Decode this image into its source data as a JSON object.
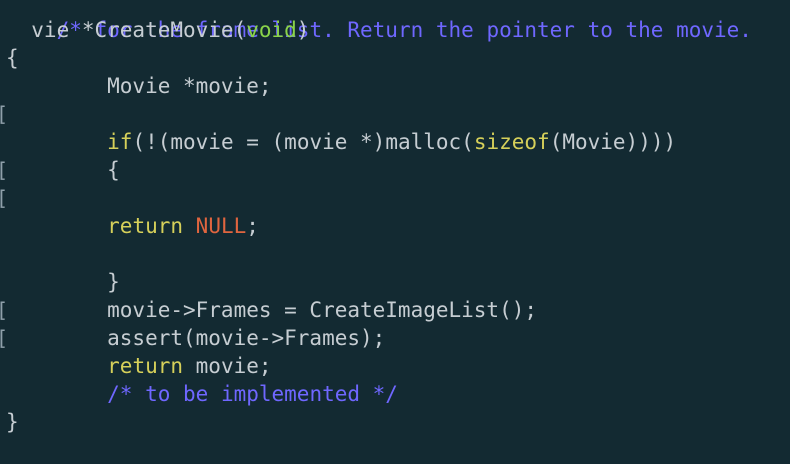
{
  "code": {
    "line0": {
      "comment": "/* for the frame list. Return the pointer to the movie."
    },
    "line1": {
      "pre": "  vie *CreateMovie(",
      "void": "void",
      "post": ")"
    },
    "line2": {
      "brace": "{"
    },
    "line3": {
      "text": "        Movie *movie;"
    },
    "line5": {
      "indent": "        ",
      "kw_if": "if",
      "mid": "(!(movie = (movie *)malloc(",
      "kw_sizeof": "sizeof",
      "tail": "(Movie))))"
    },
    "line6": {
      "text": "        {"
    },
    "line8": {
      "indent": "        ",
      "kw_return": "return",
      "space": " ",
      "null": "NULL",
      "semi": ";"
    },
    "line10": {
      "text": "        }"
    },
    "line11": {
      "text": "        movie->Frames = CreateImageList();"
    },
    "line12": {
      "text": "        assert(movie->Frames);"
    },
    "line13": {
      "indent": "        ",
      "kw_return": "return",
      "rest": " movie;"
    },
    "line14": {
      "indent": "        ",
      "comment": "/* to be implemented */"
    },
    "line15": {
      "brace": "}"
    }
  },
  "gutter": {
    "mark": "["
  },
  "colors": {
    "background": "#132a32",
    "comment": "#6f67ff",
    "keyword": "#d6d05a",
    "type": "#8ad34a",
    "constant": "#e0653f",
    "text": "#c6cdd2"
  }
}
